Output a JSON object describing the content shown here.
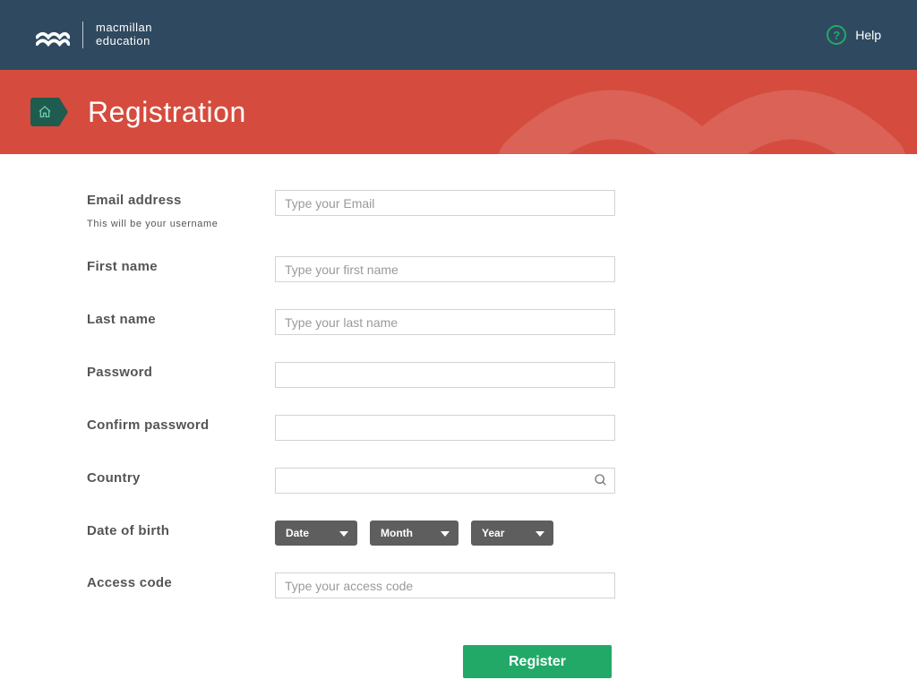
{
  "header": {
    "brand_line1": "macmillan",
    "brand_line2": "education",
    "help_label": "Help"
  },
  "banner": {
    "title": "Registration"
  },
  "form": {
    "email": {
      "label": "Email address",
      "sublabel": "This will be your username",
      "placeholder": "Type your Email"
    },
    "first_name": {
      "label": "First name",
      "placeholder": "Type your first name"
    },
    "last_name": {
      "label": "Last name",
      "placeholder": "Type your last name"
    },
    "password": {
      "label": "Password"
    },
    "confirm_password": {
      "label": "Confirm password"
    },
    "country": {
      "label": "Country"
    },
    "dob": {
      "label": "Date of birth",
      "date": "Date",
      "month": "Month",
      "year": "Year"
    },
    "access_code": {
      "label": "Access code",
      "placeholder": "Type your access code"
    },
    "register": "Register"
  }
}
